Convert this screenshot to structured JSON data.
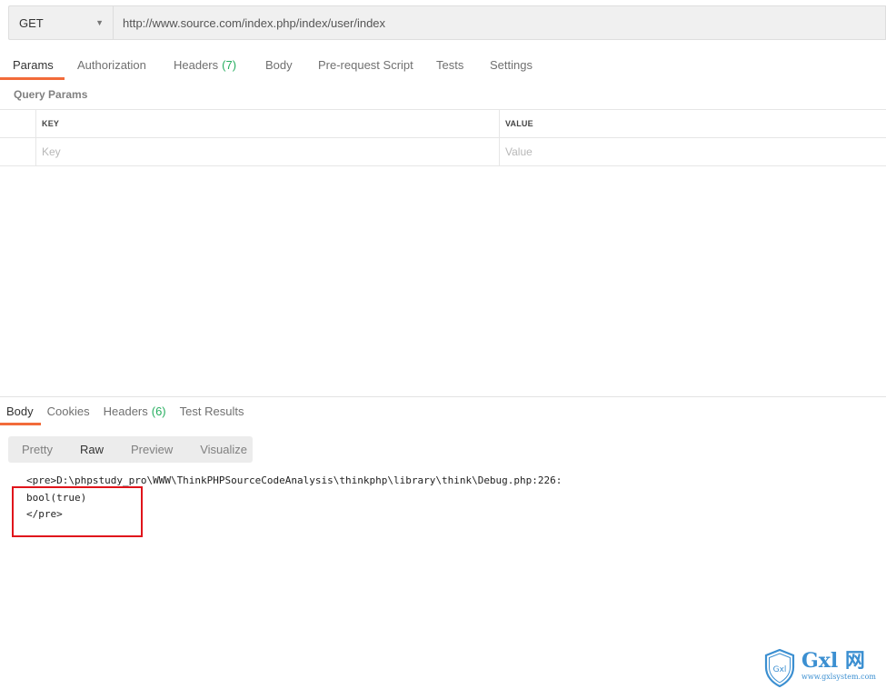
{
  "request": {
    "method": "GET",
    "url": "http://www.source.com/index.php/index/user/index"
  },
  "request_tabs": [
    {
      "label": "Params",
      "count": ""
    },
    {
      "label": "Authorization",
      "count": ""
    },
    {
      "label": "Headers",
      "count": "(7)"
    },
    {
      "label": "Body",
      "count": ""
    },
    {
      "label": "Pre-request Script",
      "count": ""
    },
    {
      "label": "Tests",
      "count": ""
    },
    {
      "label": "Settings",
      "count": ""
    }
  ],
  "query_params": {
    "section_label": "Query Params",
    "columns": {
      "key": "KEY",
      "value": "VALUE"
    },
    "key_placeholder": "Key",
    "value_placeholder": "Value"
  },
  "response_tabs": [
    {
      "label": "Body",
      "count": ""
    },
    {
      "label": "Cookies",
      "count": ""
    },
    {
      "label": "Headers",
      "count": "(6)"
    },
    {
      "label": "Test Results",
      "count": ""
    }
  ],
  "view_modes": [
    "Pretty",
    "Raw",
    "Preview",
    "Visualize"
  ],
  "response_body": {
    "lines": [
      "<pre>D:\\phpstudy_pro\\WWW\\ThinkPHPSourceCodeAnalysis\\thinkphp\\library\\think\\Debug.php:226:",
      "bool(true)",
      "</pre>"
    ]
  },
  "colors": {
    "active_tab_indicator": "#f26b3a",
    "count_green": "#27ae60",
    "highlight_red": "#e0141b",
    "watermark_blue": "#3b8fd1"
  },
  "watermark": {
    "logo_text": "Gxl",
    "brand": "Gxl 网",
    "url": "www.gxlsystem.com"
  }
}
